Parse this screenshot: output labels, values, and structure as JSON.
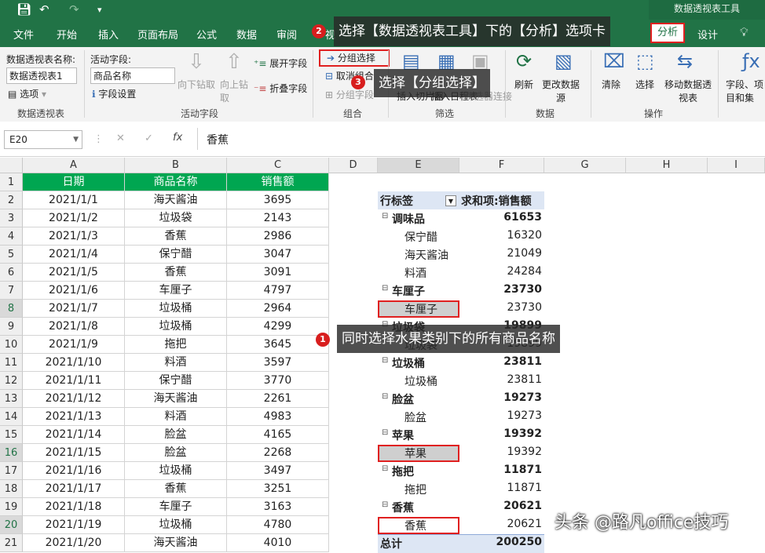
{
  "titlebar": {
    "context_title": "数据透视表工具"
  },
  "tabs": [
    "文件",
    "开始",
    "插入",
    "页面布局",
    "公式",
    "数据",
    "审阅",
    "视",
    "分析",
    "设计"
  ],
  "tab_analyze": "分析",
  "tab_design": "设计",
  "ribbon": {
    "pivot_name_label": "数据透视表名称:",
    "pivot_name_value": "数据透视表1",
    "options": "选项",
    "active_field_label": "活动字段:",
    "active_field_value": "商品名称",
    "field_settings": "字段设置",
    "drill_down": "向下钻取",
    "drill_up": "向上钻取",
    "expand_field": "展开字段",
    "collapse_field": "折叠字段",
    "group_selection": "分组选择",
    "ungroup": "取消组合",
    "group_field": "分组字段",
    "insert_slicer": "插入切片器",
    "insert_timeline": "插入日程表",
    "filter_connections": "筛选器连接",
    "refresh": "刷新",
    "change_source": "更改数据源",
    "clear": "清除",
    "select": "选择",
    "move_pivot": "移动数据透视表",
    "fields_items": "字段、项目和集",
    "groups": [
      "数据透视表",
      "活动字段",
      "组合",
      "筛选",
      "数据",
      "操作"
    ]
  },
  "formula_bar": {
    "name_box": "E20",
    "fx": "fx",
    "content": "香蕉"
  },
  "columns": [
    "A",
    "B",
    "C",
    "D",
    "E",
    "F",
    "G",
    "H",
    "I"
  ],
  "rows": [
    "1",
    "2",
    "3",
    "4",
    "5",
    "6",
    "7",
    "8",
    "9",
    "10",
    "11",
    "12",
    "13",
    "14",
    "15",
    "16",
    "17",
    "18",
    "19",
    "20",
    "21"
  ],
  "table": {
    "headers": [
      "日期",
      "商品名称",
      "销售额"
    ],
    "rows": [
      [
        "2021/1/1",
        "海天酱油",
        "3695"
      ],
      [
        "2021/1/2",
        "垃圾袋",
        "2143"
      ],
      [
        "2021/1/3",
        "香蕉",
        "2986"
      ],
      [
        "2021/1/4",
        "保宁醋",
        "3047"
      ],
      [
        "2021/1/5",
        "香蕉",
        "3091"
      ],
      [
        "2021/1/6",
        "车厘子",
        "4797"
      ],
      [
        "2021/1/7",
        "垃圾桶",
        "2964"
      ],
      [
        "2021/1/8",
        "垃圾桶",
        "4299"
      ],
      [
        "2021/1/9",
        "拖把",
        "3645"
      ],
      [
        "2021/1/10",
        "料酒",
        "3597"
      ],
      [
        "2021/1/11",
        "保宁醋",
        "3770"
      ],
      [
        "2021/1/12",
        "海天酱油",
        "2261"
      ],
      [
        "2021/1/13",
        "料酒",
        "4983"
      ],
      [
        "2021/1/14",
        "脸盆",
        "4165"
      ],
      [
        "2021/1/15",
        "脸盆",
        "2268"
      ],
      [
        "2021/1/16",
        "垃圾桶",
        "3497"
      ],
      [
        "2021/1/17",
        "香蕉",
        "3251"
      ],
      [
        "2021/1/18",
        "车厘子",
        "3163"
      ],
      [
        "2021/1/19",
        "垃圾桶",
        "4780"
      ],
      [
        "2021/1/20",
        "海天酱油",
        "4010"
      ]
    ]
  },
  "pivot": {
    "row_label": "行标签",
    "sum_label": "求和项:销售额",
    "rows": [
      {
        "label": "调味品",
        "value": "61653",
        "level": 0
      },
      {
        "label": "保宁醋",
        "value": "16320",
        "level": 1
      },
      {
        "label": "海天酱油",
        "value": "21049",
        "level": 1
      },
      {
        "label": "料酒",
        "value": "24284",
        "level": 1
      },
      {
        "label": "车厘子",
        "value": "23730",
        "level": 0
      },
      {
        "label": "车厘子",
        "value": "23730",
        "level": 1
      },
      {
        "label": "垃圾袋",
        "value": "19899",
        "level": 0
      },
      {
        "label": "垃圾袋",
        "value": "19899",
        "level": 1
      },
      {
        "label": "垃圾桶",
        "value": "23811",
        "level": 0
      },
      {
        "label": "垃圾桶",
        "value": "23811",
        "level": 1
      },
      {
        "label": "脸盆",
        "value": "19273",
        "level": 0
      },
      {
        "label": "脸盆",
        "value": "19273",
        "level": 1
      },
      {
        "label": "苹果",
        "value": "19392",
        "level": 0
      },
      {
        "label": "苹果",
        "value": "19392",
        "level": 1
      },
      {
        "label": "拖把",
        "value": "11871",
        "level": 0
      },
      {
        "label": "拖把",
        "value": "11871",
        "level": 1
      },
      {
        "label": "香蕉",
        "value": "20621",
        "level": 0
      },
      {
        "label": "香蕉",
        "value": "20621",
        "level": 1
      }
    ],
    "total_label": "总计",
    "total_value": "200250"
  },
  "callouts": {
    "step1": "同时选择水果类别下的所有商品名称",
    "step2": "选择【数据透视表工具】下的【分析】选项卡",
    "step3": "选择【分组选择】"
  },
  "badges": [
    "1",
    "2",
    "3"
  ],
  "watermark": "头条 @路凡office技巧",
  "colors": {
    "excel_green": "#217346",
    "header_green": "#00a651",
    "highlight_red": "#e02020"
  }
}
